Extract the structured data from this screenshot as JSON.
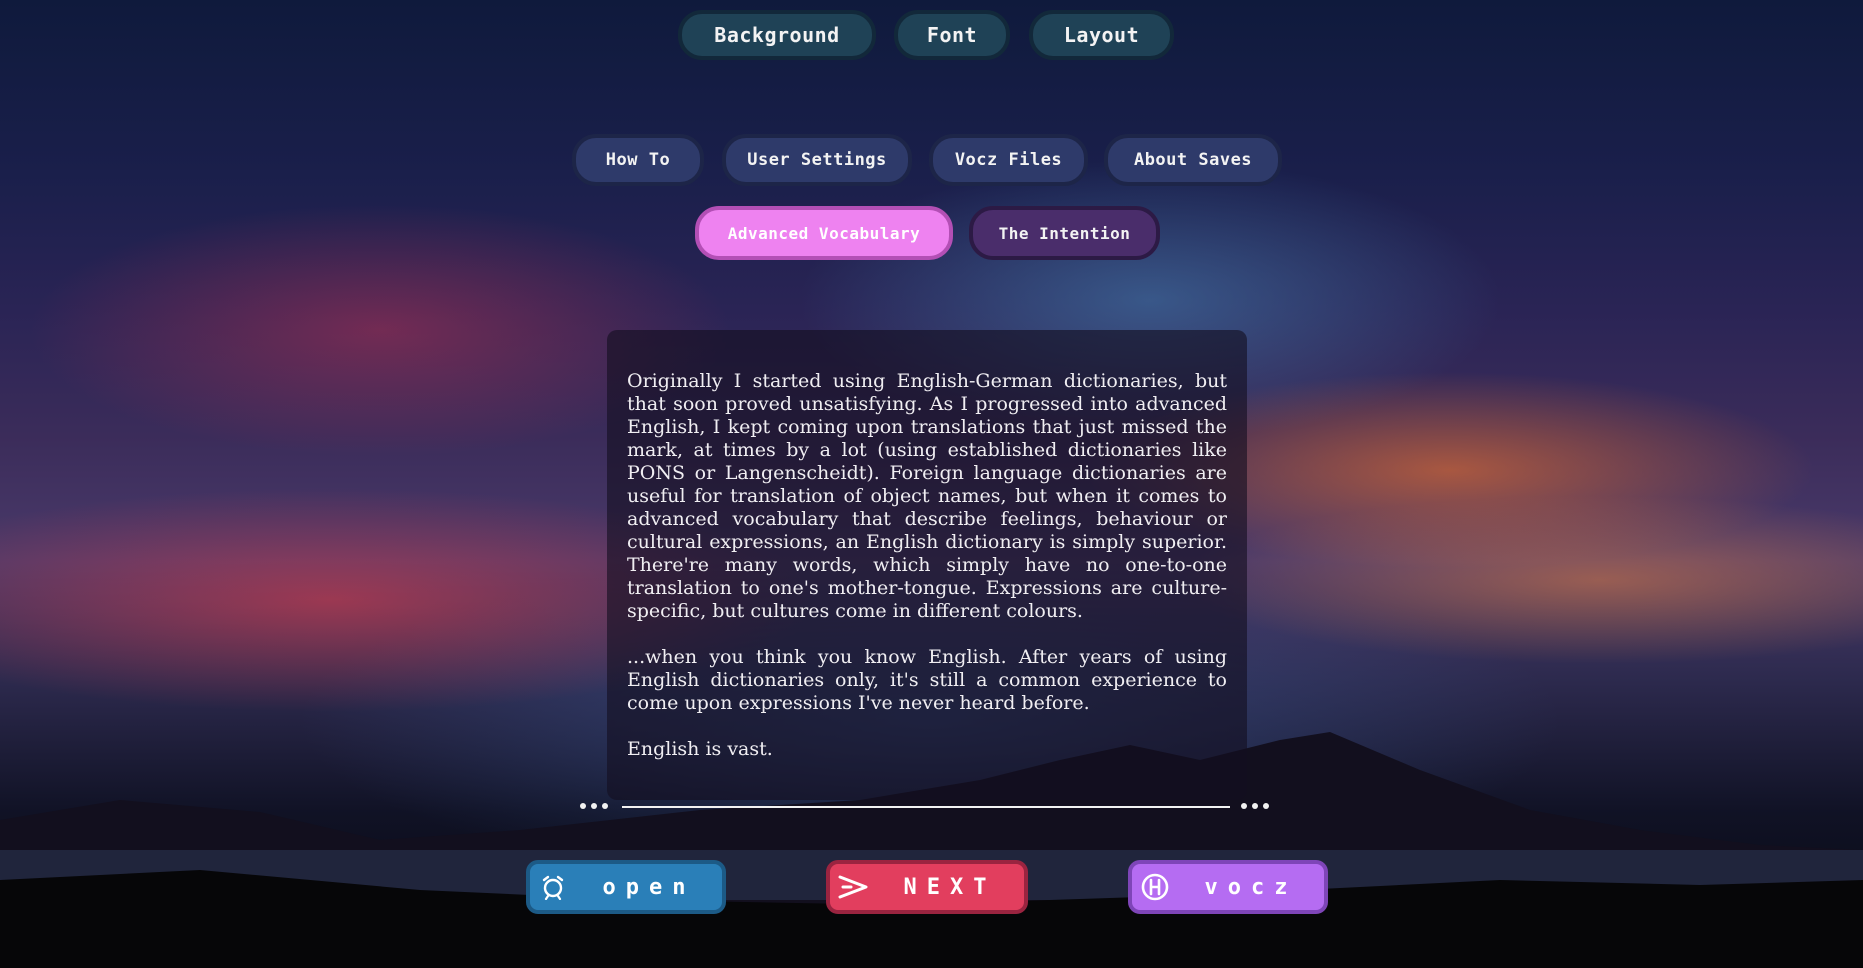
{
  "top_menu": {
    "background": "Background",
    "font": "Font",
    "layout": "Layout"
  },
  "nav": {
    "how_to": "How To",
    "user_settings": "User Settings",
    "vocz_files": "Vocz Files",
    "about_saves": "About Saves",
    "advanced_vocabulary": "Advanced Vocabulary",
    "the_intention": "The Intention"
  },
  "active_tab": "Advanced Vocabulary",
  "content": {
    "paragraph_1": "Originally I started using English-German dictionaries, but that soon proved unsatisfying. As I progressed into advanced English, I kept coming upon translations that just missed the mark, at times by a lot (using established dictionaries like PONS or Langenscheidt). Foreign language dictionaries are useful for translation of object names, but when it comes to advanced vocabulary that describe feelings, behaviour or cultural expressions, an English dictionary is simply superior. There're many words, which simply have no one-to-one translation to one's mother-tongue. Expressions are culture-specific, but cultures come in different colours.",
    "paragraph_2": "...when you think you know English. After years of using English dictionaries only, it's still a common experience to come upon expressions I've never heard before.",
    "paragraph_3": "English is vast."
  },
  "actions": {
    "open": "open",
    "next": "NEXT",
    "vocz": "vocz"
  },
  "icons": {
    "open": "alarm-clock-icon",
    "next": "greater-than-arrow-icon",
    "vocz": "h-circle-icon"
  },
  "colors": {
    "top_button": "#1f4256",
    "nav_button": "#2e3a6a",
    "active_tab": "#ee82f0",
    "intention_tab": "#4a2d6b",
    "open_button": "#2a7fb8",
    "next_button": "#e23e5e",
    "vocz_button": "#b56cf2"
  }
}
